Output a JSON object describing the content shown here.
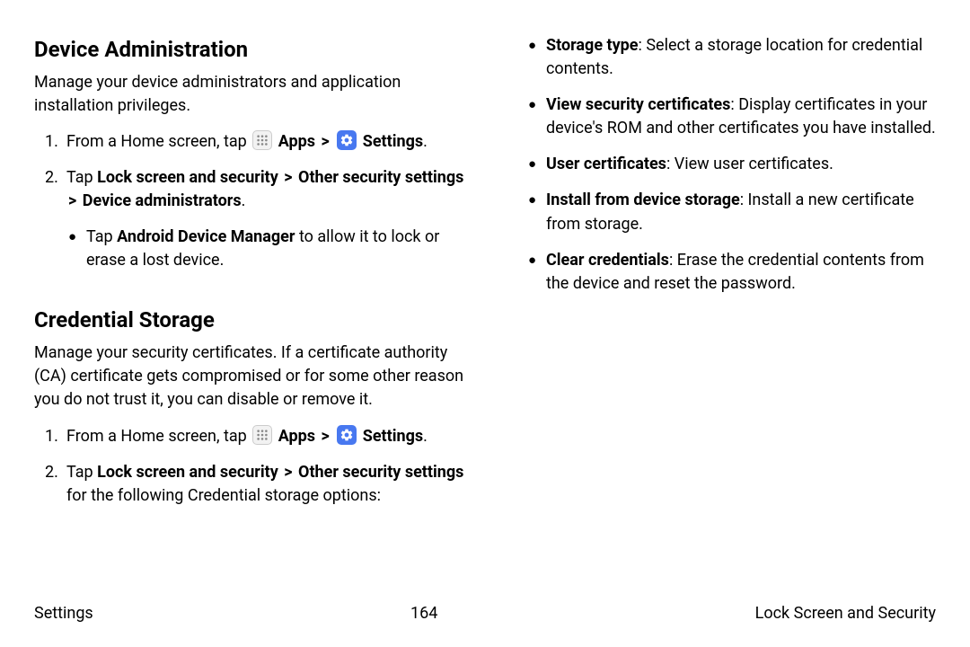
{
  "sections": {
    "device_admin": {
      "heading": "Device Administration",
      "description": "Manage your device administrators and application installation privileges.",
      "step1_prefix": "From a Home screen, tap ",
      "step1_apps": "Apps",
      "step1_settings": "Settings",
      "step2_tap": "Tap ",
      "step2_lock": "Lock screen and security",
      "step2_other": "Other security settings",
      "step2_devadmin": "Device administrators",
      "bullet1_tap": "Tap ",
      "bullet1_adm": "Android Device Manager",
      "bullet1_rest": " to allow it to lock or erase a lost device."
    },
    "cred_storage": {
      "heading": "Credential Storage",
      "description": "Manage your security certificates. If a certificate authority (CA) certificate gets compromised or for some other reason you do not trust it, you can disable or remove it.",
      "step1_prefix": "From a Home screen, tap ",
      "step1_apps": "Apps",
      "step1_settings": "Settings",
      "step2_tap": "Tap ",
      "step2_lock": "Lock screen and security",
      "step2_other": "Other security settings",
      "step2_rest": " for the following Credential storage options:"
    },
    "cred_options": {
      "storage_type_bold": "Storage type",
      "storage_type_rest": ": Select a storage location for credential contents.",
      "view_sec_bold": "View security certificates",
      "view_sec_rest": ": Display certificates in your device's ROM and other certificates you have installed.",
      "user_cert_bold": "User certificates",
      "user_cert_rest": ": View user certificates.",
      "install_bold": "Install from device storage",
      "install_rest": ": Install a new certificate from storage.",
      "clear_bold": "Clear credentials",
      "clear_rest": ": Erase the credential contents from the device and reset the password."
    }
  },
  "footer": {
    "left": "Settings",
    "center": "164",
    "right": "Lock Screen and Security"
  },
  "symbols": {
    "chevron": ">",
    "bullet": "●",
    "period": "."
  }
}
